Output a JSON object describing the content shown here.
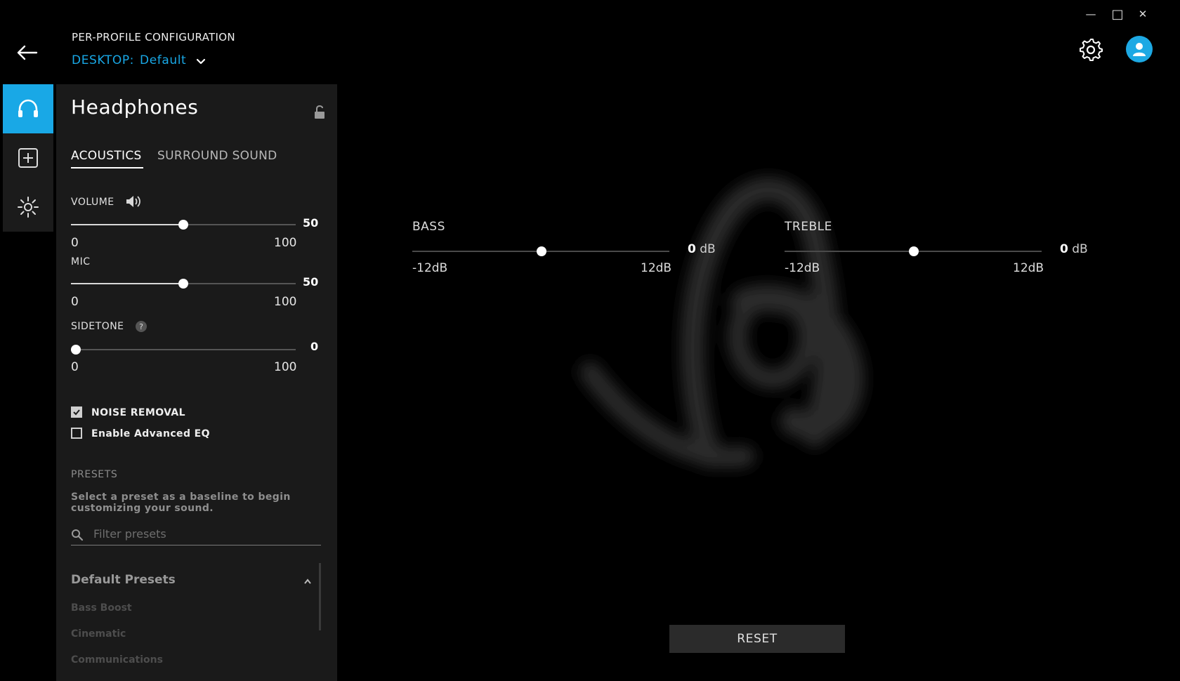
{
  "window": {
    "minimize_glyph": "—",
    "maximize_glyph": "□",
    "close_glyph": "✕"
  },
  "header": {
    "caption": "PER-PROFILE CONFIGURATION",
    "profile_prefix": "DESKTOP:",
    "profile_name": "Default"
  },
  "icons": {
    "back": "arrow-left-icon",
    "settings": "gear-icon",
    "account": "user-icon",
    "rail": [
      "headphones-icon",
      "add-square-icon",
      "brightness-icon"
    ],
    "lock": "unlocked-padlock-icon",
    "speaker": "speaker-icon",
    "search": "search-icon"
  },
  "colors": {
    "accent": "#19a8e6",
    "panel": "#1a1a1a",
    "background": "#000000"
  },
  "panel": {
    "title": "Headphones",
    "tabs": [
      {
        "label": "ACOUSTICS",
        "active": true
      },
      {
        "label": "SURROUND SOUND",
        "active": false
      }
    ],
    "sliders": {
      "volume": {
        "label": "VOLUME",
        "min": "0",
        "max": "100",
        "value": "50"
      },
      "mic": {
        "label": "MIC",
        "min": "0",
        "max": "100",
        "value": "50"
      },
      "sidetone": {
        "label": "SIDETONE",
        "min": "0",
        "max": "100",
        "value": "0",
        "help": "?"
      }
    },
    "checkboxes": {
      "noise_removal": {
        "label": "NOISE REMOVAL",
        "checked": true
      },
      "advanced_eq": {
        "label": "Enable Advanced EQ",
        "checked": false
      }
    },
    "presets": {
      "heading": "PRESETS",
      "description": "Select a preset as a baseline to begin customizing your sound.",
      "filter_placeholder": "Filter presets",
      "group_title": "Default Presets",
      "items": [
        "Bass Boost",
        "Cinematic",
        "Communications"
      ]
    }
  },
  "eq": {
    "bass": {
      "label": "BASS",
      "min": "-12dB",
      "max": "12dB",
      "value": "0",
      "unit": "dB"
    },
    "treble": {
      "label": "TREBLE",
      "min": "-12dB",
      "max": "12dB",
      "value": "0",
      "unit": "dB"
    }
  },
  "reset_label": "RESET"
}
